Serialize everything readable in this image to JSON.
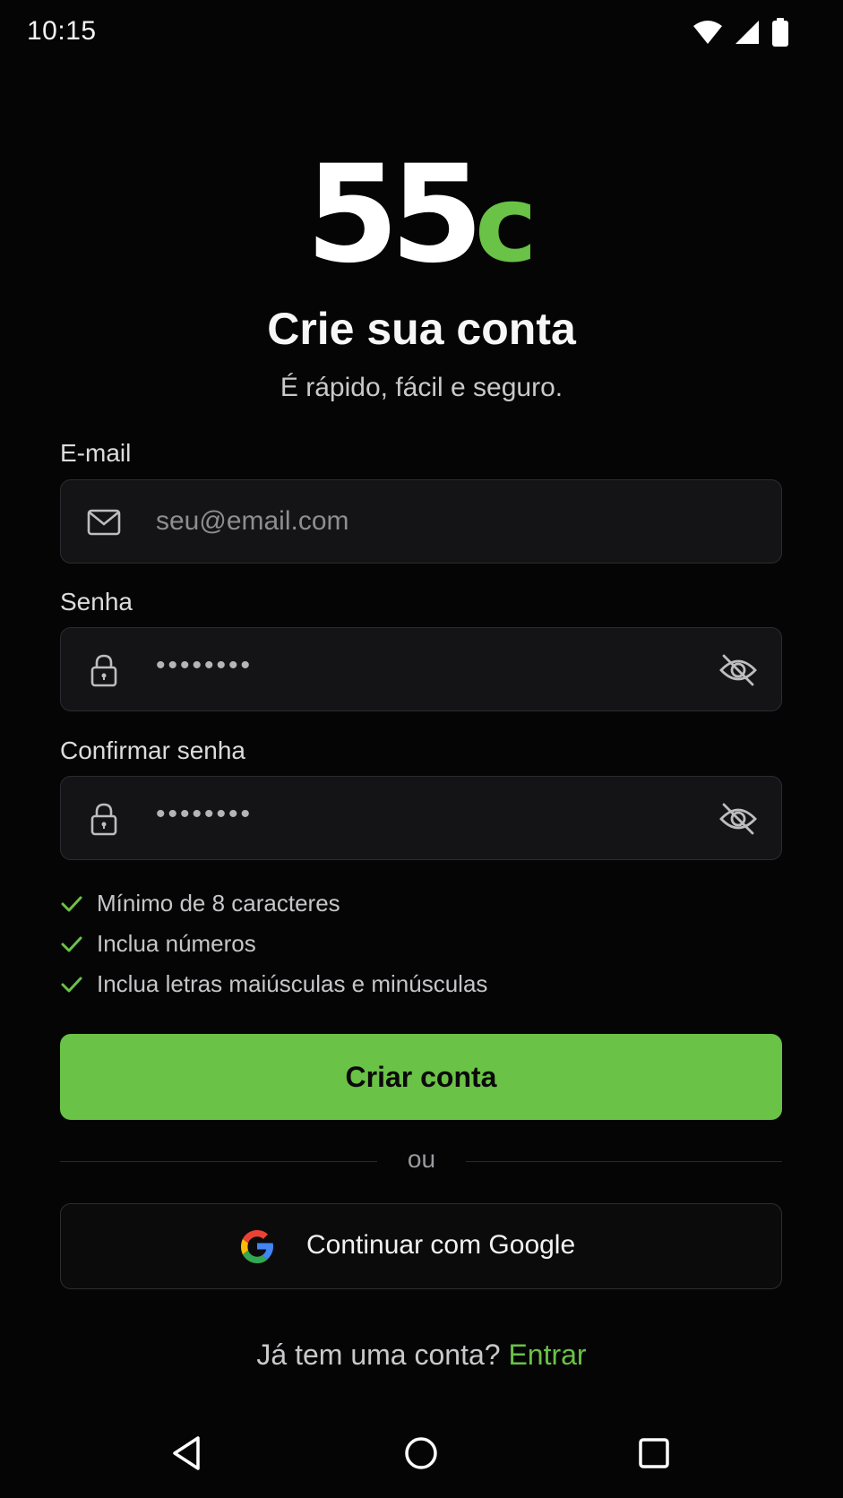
{
  "status_bar": {
    "time": "10:15",
    "icons": [
      "wifi-icon",
      "cell-signal-icon",
      "battery-icon"
    ]
  },
  "logo": {
    "main": "55",
    "accent": "c",
    "accent_color": "#6ac246"
  },
  "header": {
    "title": "Crie sua conta",
    "subtitle": "É rápido, fácil e seguro."
  },
  "form": {
    "email": {
      "label": "E-mail",
      "placeholder": "seu@email.com",
      "icon": "mail-icon"
    },
    "password": {
      "label": "Senha",
      "masked_value": "••••••••",
      "icon": "lock-icon",
      "toggle_icon": "eye-off-icon"
    },
    "confirm_password": {
      "label": "Confirmar senha",
      "masked_value": "••••••••",
      "icon": "lock-icon",
      "toggle_icon": "eye-off-icon"
    },
    "rules": [
      {
        "text": "Mínimo de 8 caracteres",
        "icon": "check-icon"
      },
      {
        "text": "Inclua números",
        "icon": "check-icon"
      },
      {
        "text": "Inclua letras maiúsculas e minúsculas",
        "icon": "check-icon"
      }
    ],
    "submit_label": "Criar conta"
  },
  "divider": {
    "text": "ou"
  },
  "google": {
    "label": "Continuar com Google",
    "icon": "google-icon"
  },
  "signin": {
    "prompt": "Já tem uma conta?",
    "link": "Entrar"
  },
  "nav_bar": {
    "icons": [
      "back-icon",
      "home-icon",
      "recents-icon"
    ]
  },
  "colors": {
    "background": "#050506",
    "accent": "#6ac246",
    "field_bg": "#141416",
    "field_border": "#2c2c30"
  }
}
